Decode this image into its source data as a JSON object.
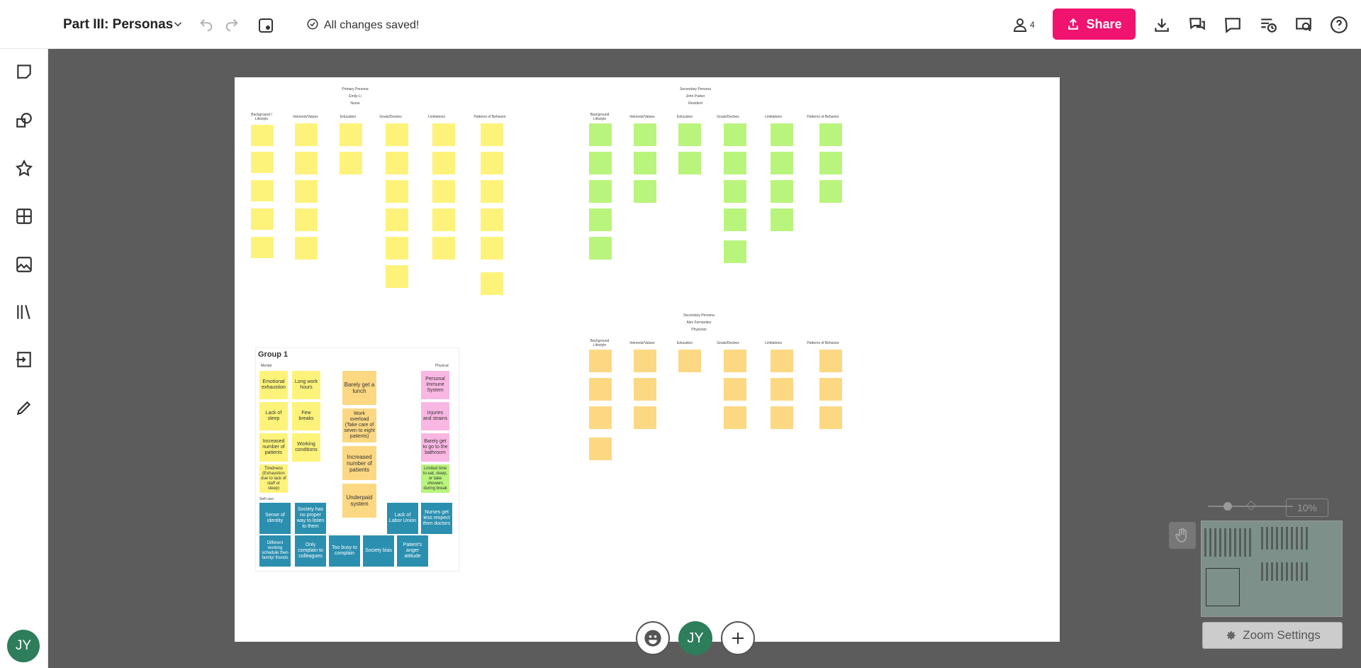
{
  "header": {
    "title": "Part III: Personas",
    "save_status": "All changes saved!",
    "participants": "4",
    "share_label": "Share"
  },
  "user": {
    "initials": "JY"
  },
  "zoom": {
    "level": "10%",
    "settings_label": "Zoom Settings"
  },
  "board": {
    "primary": {
      "heading": "Primary Persona",
      "name": "Emily Li",
      "role": "Nurse",
      "columns": [
        "Background / Lifestyle",
        "Interests/Values",
        "Education",
        "Goals/Desires",
        "Limitations",
        "Patterns of Behavior"
      ]
    },
    "secondary1": {
      "heading": "Secondary Persona",
      "name": "John Parker",
      "role": "Resident",
      "columns": [
        "Background Lifestyle",
        "Interests/Values",
        "Education",
        "Goals/Desires",
        "Limitations",
        "Patterns of Behavior"
      ]
    },
    "secondary2": {
      "heading": "Secondary Persona",
      "name": "Alex Fernandez",
      "role": "Physician",
      "columns": [
        "Background Lifestyle",
        "Interests/Values",
        "Education",
        "Goals/Desires",
        "Limitations",
        "Patterns of Behavior"
      ]
    },
    "group": {
      "title": "Group 1",
      "mental": "Mental",
      "physical": "Physical",
      "selfcare": "Self-care",
      "notes": [
        "Emotional exhaustion",
        "Long work hours",
        "Barely get a lunch",
        "Personal Immune System",
        "Lack of sleep",
        "Few breaks",
        "Work overload (Take care of seven to eight patients)",
        "Injuries and strains",
        "Increased number of patients",
        "Working conditions",
        "Increased number of patients",
        "Barely get to go to the bathroom",
        "Tiredness (Exhaustion due to lack of staff or sleep)",
        "Underpaid system",
        "Limited time to eat, sleep, or take showers during break"
      ],
      "blue_notes": [
        "Sense of identity",
        "Society has no proper way to listen to them",
        "Lack of Labor Union",
        "Nurses get less respect then doctors",
        "Different working schedule then family/ friends",
        "Only complain to colleagues",
        "Too busy to complain",
        "Society bias",
        "Patient's anger attitude"
      ]
    }
  }
}
